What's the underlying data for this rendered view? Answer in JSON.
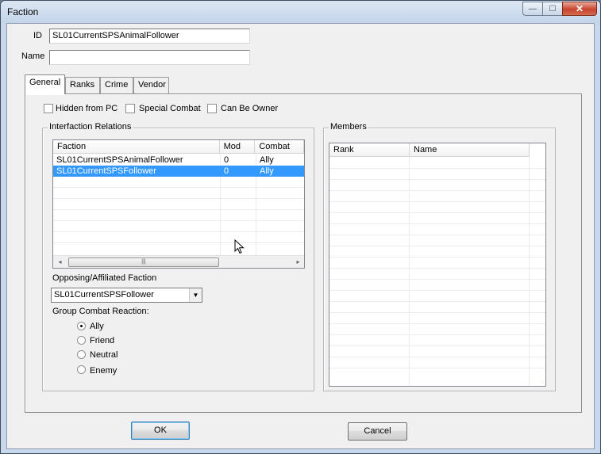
{
  "window": {
    "title": "Faction",
    "minimize_glyph": "—",
    "maximize_glyph": "☐",
    "close_glyph": "✕"
  },
  "form": {
    "id_label": "ID",
    "id_value": "SL01CurrentSPSAnimalFollower",
    "name_label": "Name",
    "name_value": ""
  },
  "tabs": [
    {
      "label": "General",
      "active": true
    },
    {
      "label": "Ranks",
      "active": false
    },
    {
      "label": "Crime",
      "active": false
    },
    {
      "label": "Vendor",
      "active": false
    }
  ],
  "flags": {
    "hidden_from_pc": {
      "label": "Hidden from PC",
      "checked": false
    },
    "special_combat": {
      "label": "Special Combat",
      "checked": false
    },
    "can_be_owner": {
      "label": "Can Be Owner",
      "checked": false
    }
  },
  "relations": {
    "group_title": "Interfaction Relations",
    "columns": [
      "Faction",
      "Mod",
      "Combat"
    ],
    "rows": [
      {
        "faction": "SL01CurrentSPSAnimalFollower",
        "mod": "0",
        "combat": "Ally",
        "selected": false
      },
      {
        "faction": "SL01CurrentSPSFollower",
        "mod": "0",
        "combat": "Ally",
        "selected": true
      }
    ],
    "scroll_left_glyph": "◂",
    "scroll_right_glyph": "▸",
    "scroll_grip": "|||",
    "opposing_label": "Opposing/Affiliated Faction",
    "opposing_value": "SL01CurrentSPSFollower",
    "combo_arrow_glyph": "▼",
    "reaction_label": "Group Combat Reaction:",
    "reactions": [
      {
        "label": "Ally",
        "selected": true
      },
      {
        "label": "Friend",
        "selected": false
      },
      {
        "label": "Neutral",
        "selected": false
      },
      {
        "label": "Enemy",
        "selected": false
      }
    ]
  },
  "members": {
    "group_title": "Members",
    "columns": [
      "Rank",
      "Name"
    ]
  },
  "buttons": {
    "ok": "OK",
    "cancel": "Cancel"
  },
  "icons": {
    "cursor": "mouse-pointer-icon"
  }
}
